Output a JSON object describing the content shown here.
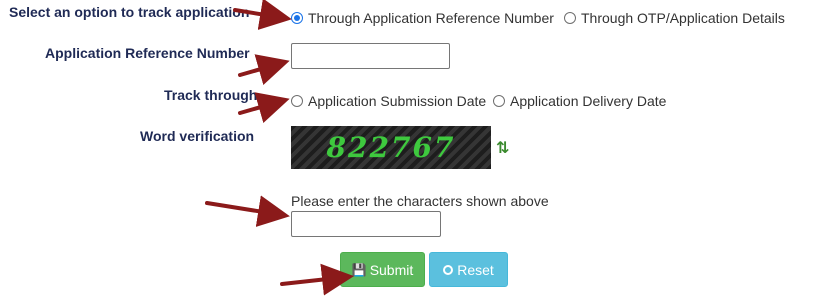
{
  "form": {
    "select_option_label": "Select an option to track application",
    "option_reference": "Through Application Reference Number",
    "option_otp": "Through OTP/Application Details",
    "reference_number_label": "Application Reference Number",
    "reference_number_value": "",
    "track_through_label": "Track through",
    "option_submission_date": "Application Submission Date",
    "option_delivery_date": "Application Delivery Date",
    "word_verification_label": "Word verification",
    "captcha_text": "822767",
    "refresh_symbol": "⇅",
    "captcha_hint": "Please enter the characters shown above",
    "captcha_input_value": "",
    "submit_label": "Submit",
    "reset_label": "Reset",
    "submit_icon": "💾"
  },
  "selected_track_option": "reference",
  "colors": {
    "label": "#1f2a55",
    "arrow": "#8b1a1a",
    "captcha_text": "#3ec93e",
    "submit": "#5cb85c",
    "reset": "#5bc0de",
    "radio_selected": "#1a73e8"
  },
  "icons": {
    "submit": "floppy-disk-icon",
    "reset": "circle-icon",
    "refresh": "refresh-icon",
    "annotation": "red-arrow-icon"
  }
}
